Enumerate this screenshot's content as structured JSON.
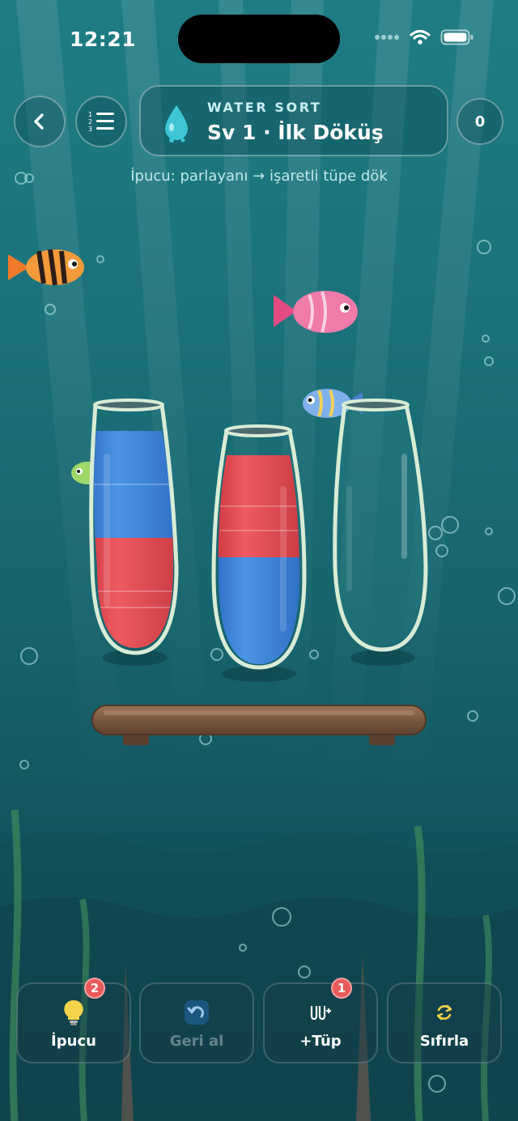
{
  "status_bar": {
    "time": "12:21"
  },
  "header": {
    "game_title": "WATER SORT",
    "level_title": "Sv 1 · İlk Döküş",
    "score": "0",
    "hint_text": "İpucu: parlayanı → işaretli tüpe dök"
  },
  "tubes": [
    {
      "layers_bottom_to_top": [
        "red",
        "blue"
      ]
    },
    {
      "layers_bottom_to_top": [
        "blue",
        "red"
      ]
    },
    {
      "layers_bottom_to_top": []
    }
  ],
  "colors": {
    "red": "#e5484f",
    "blue": "#3c83d6"
  },
  "toolbar": {
    "hint": {
      "label": "İpucu",
      "badge": "2",
      "icon": "lightbulb-icon"
    },
    "undo": {
      "label": "Geri al",
      "icon": "undo-icon"
    },
    "add_tube": {
      "label": "+Tüp",
      "badge": "1",
      "icon": "add-tube-icon"
    },
    "reset": {
      "label": "Sıfırla",
      "icon": "reset-icon"
    }
  }
}
